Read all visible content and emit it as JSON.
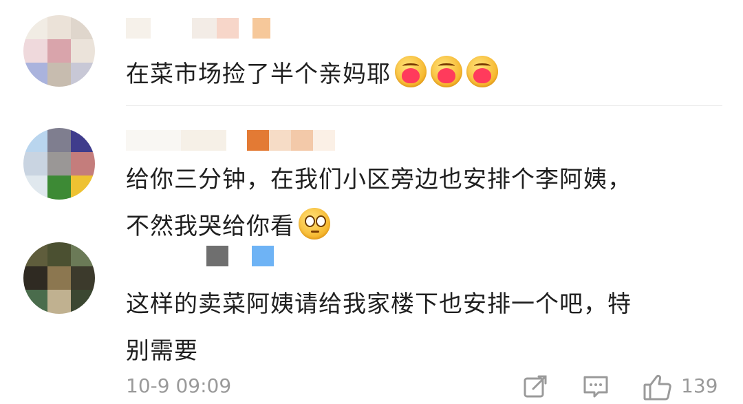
{
  "comments": [
    {
      "text": "在菜市场捡了半个亲妈耶",
      "emojis": [
        "hug",
        "hug",
        "hug"
      ]
    },
    {
      "text_line1": "给你三分钟，在我们小区旁边也安排个李阿姨，",
      "text_line2": "不然我哭给你看",
      "emojis": [
        "roll"
      ]
    },
    {
      "text_line1": "这样的卖菜阿姨请给我家楼下也安排一个吧，特",
      "text_line2": "别需要"
    }
  ],
  "footer": {
    "time": "10-9 09:09",
    "likes": "139",
    "share_icon": "share-icon",
    "comment_icon": "comment-icon",
    "like_icon": "thumbs-up-icon"
  },
  "colors": {
    "text": "#1f1f1f",
    "meta": "#9a9a9a",
    "divider": "#ececec"
  }
}
